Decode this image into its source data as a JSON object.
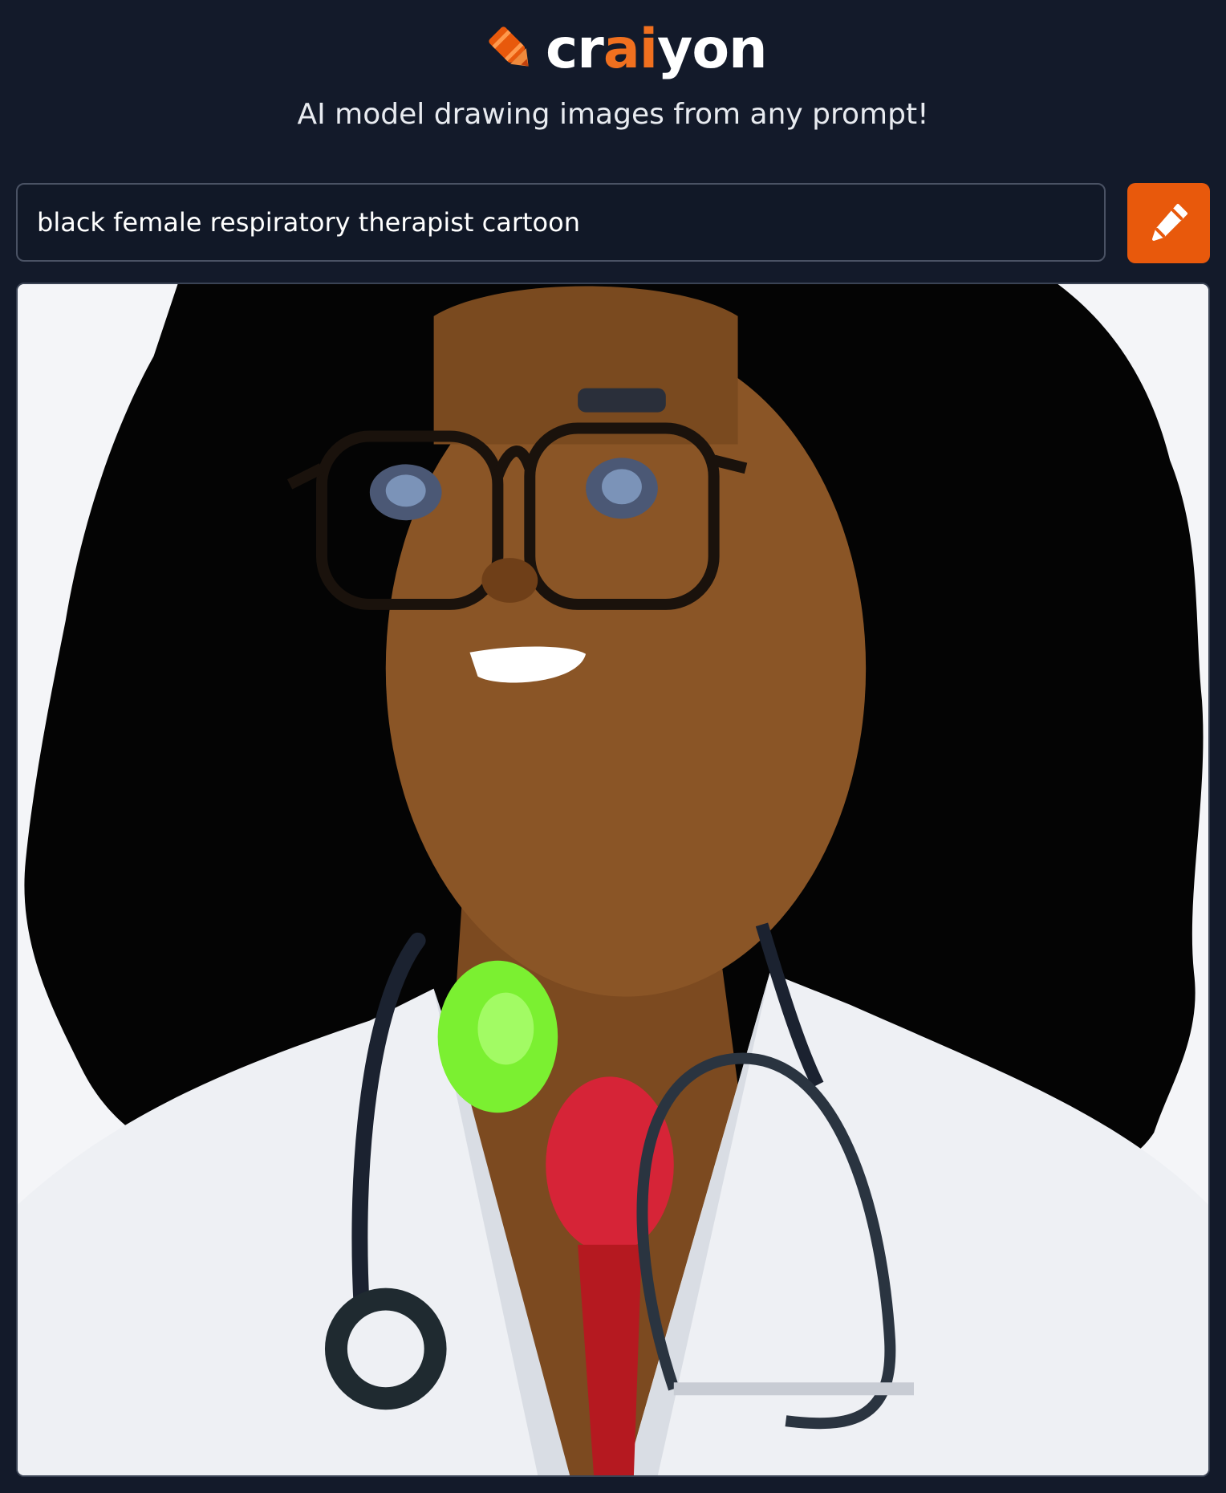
{
  "header": {
    "brand_prefix": "cr",
    "brand_ai": "ai",
    "brand_suffix": "yon",
    "tagline": "AI model drawing images from any prompt!",
    "logo_icon": "crayon-icon"
  },
  "prompt": {
    "value": "black female respiratory therapist cartoon",
    "button_icon": "pencil-icon"
  },
  "result": {
    "image_description_icon": "generated-image"
  },
  "colors": {
    "background": "#131a2a",
    "accent": "#e8590c",
    "brand_ai": "#f0701f"
  }
}
